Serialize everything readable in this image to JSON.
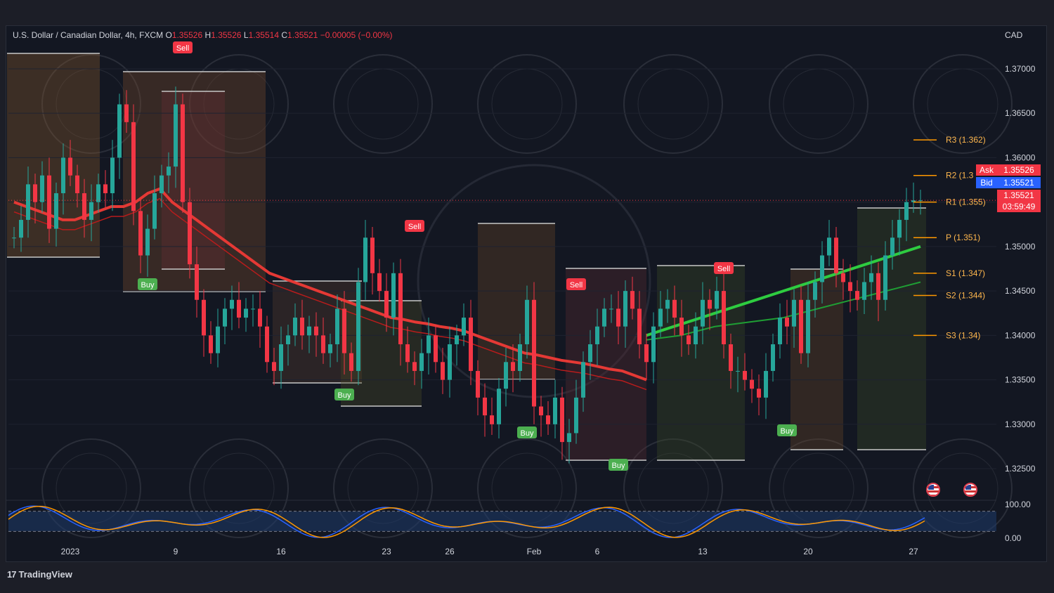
{
  "symbol": {
    "name": "U.S. Dollar / Canadian Dollar, 4h, FXCM",
    "open_label": "O",
    "open": "1.35526",
    "high_label": "H",
    "high": "1.35526",
    "low_label": "L",
    "low": "1.35514",
    "close_label": "C",
    "close": "1.35521",
    "change": "−0.00005 (−0.00%)"
  },
  "currency": "CAD",
  "quote": {
    "ask_label": "Ask",
    "ask": "1.35526",
    "bid_label": "Bid",
    "bid": "1.35521",
    "last": "1.35521",
    "countdown": "03:59:49"
  },
  "branding": {
    "logo_mark": "17",
    "logo_text": "TradingView"
  },
  "colors": {
    "bull": "#26a69a",
    "bear": "#f23645",
    "sell": "#f23645",
    "buy": "#4caf50",
    "pivot": "#ff9800",
    "background": "#131722"
  },
  "chart_data": {
    "type": "line",
    "title": "U.S. Dollar / Canadian Dollar, 4h, FXCM",
    "ylim": [
      1.322,
      1.373
    ],
    "y_ticks": [
      "1.37000",
      "1.36500",
      "1.36000",
      "1.35500",
      "1.35000",
      "1.34500",
      "1.34000",
      "1.33500",
      "1.33000",
      "1.32500"
    ],
    "y_tick_values": [
      1.37,
      1.365,
      1.36,
      1.355,
      1.35,
      1.345,
      1.34,
      1.335,
      1.33,
      1.325
    ],
    "x_ticks": [
      "2023",
      "9",
      "16",
      "23",
      "26",
      "Feb",
      "6",
      "13",
      "20",
      "27"
    ],
    "x_tick_index": [
      8,
      23,
      38,
      53,
      62,
      74,
      83,
      98,
      113,
      128
    ],
    "x_count": 130,
    "series": [
      {
        "values": [
          1.351,
          1.353,
          1.357,
          1.355,
          1.358,
          1.352,
          1.356,
          1.36,
          1.358,
          1.356,
          1.353,
          1.355,
          1.357,
          1.356,
          1.36,
          1.366,
          1.364,
          1.354,
          1.349,
          1.352,
          1.356,
          1.358,
          1.359,
          1.366,
          1.355,
          1.348,
          1.344,
          1.34,
          1.338,
          1.341,
          1.343,
          1.344,
          1.342,
          1.343,
          1.343,
          1.341,
          1.337,
          1.336,
          1.339,
          1.34,
          1.342,
          1.34,
          1.341,
          1.34,
          1.338,
          1.339,
          1.343,
          1.338,
          1.336,
          1.346,
          1.351,
          1.347,
          1.345,
          1.342,
          1.347,
          1.339,
          1.337,
          1.336,
          1.338,
          1.34,
          1.337,
          1.335,
          1.339,
          1.34,
          1.342,
          1.336,
          1.333,
          1.331,
          1.33,
          1.334,
          1.337,
          1.336,
          1.339,
          1.344,
          1.332,
          1.331,
          1.33,
          1.333,
          1.328,
          1.329,
          1.333,
          1.337,
          1.339,
          1.341,
          1.343,
          1.343,
          1.341,
          1.345,
          1.343,
          1.339,
          1.337,
          1.341,
          1.343,
          1.344,
          1.342,
          1.34,
          1.339,
          1.341,
          1.344,
          1.343,
          1.345,
          1.339,
          1.336,
          1.336,
          1.335,
          1.334,
          1.333,
          1.336,
          1.339,
          1.342,
          1.341,
          1.344,
          1.338,
          1.344,
          1.346,
          1.349,
          1.351,
          1.347,
          1.346,
          1.345,
          1.344,
          1.346,
          1.347,
          1.344,
          1.349,
          1.351,
          1.353,
          1.355,
          1.3552,
          1.3552
        ]
      },
      {
        "values": [
          1.355,
          1.3545,
          1.354,
          1.3535,
          1.353,
          1.353,
          1.3535,
          1.354,
          1.3545,
          1.3545,
          1.355,
          1.356,
          1.3565,
          1.355,
          1.354,
          1.353,
          1.352,
          1.351,
          1.35,
          1.349,
          1.348,
          1.347,
          1.3465,
          1.346,
          1.3455,
          1.345,
          1.3445,
          1.344,
          1.3435,
          1.343,
          1.3425,
          1.342,
          1.3418,
          1.3415,
          1.3413,
          1.341,
          1.3408,
          1.3405,
          1.34,
          1.3395,
          1.339,
          1.3385,
          1.338,
          1.3378,
          1.3375,
          1.3372,
          1.337,
          1.3368,
          1.3365,
          1.3362,
          1.336,
          1.3355,
          1.335
        ]
      },
      {
        "values": [
          1.34,
          1.341,
          1.342,
          1.343,
          1.344,
          1.345,
          1.346,
          1.347,
          1.348,
          1.349,
          1.35
        ]
      },
      {
        "values": [
          1.3395,
          1.34,
          1.341,
          1.3415,
          1.342,
          1.343,
          1.344,
          1.345,
          1.346
        ]
      }
    ],
    "signals": [
      {
        "label": "Sell",
        "x": 24
      },
      {
        "label": "Buy",
        "x": 19
      },
      {
        "label": "Sell",
        "x": 57
      },
      {
        "label": "Buy",
        "x": 47
      },
      {
        "label": "Sell",
        "x": 80
      },
      {
        "label": "Buy",
        "x": 73
      },
      {
        "label": "Sell",
        "x": 101
      },
      {
        "label": "Buy",
        "x": 86
      },
      {
        "label": "Buy",
        "x": 110
      }
    ],
    "pivots": [
      {
        "label": "R3 (1.362)",
        "value": 1.362
      },
      {
        "label": "R2 (1.3",
        "value": 1.358
      },
      {
        "label": "R1 (1.355)",
        "value": 1.355
      },
      {
        "label": "P (1.351)",
        "value": 1.351
      },
      {
        "label": "S1 (1.347)",
        "value": 1.347
      },
      {
        "label": "S2 (1.344)",
        "value": 1.3445
      },
      {
        "label": "S3 (1.34)",
        "value": 1.34
      }
    ],
    "oscillator": {
      "y_ticks": [
        "100.00",
        "0.00"
      ],
      "levels": [
        80,
        20
      ]
    }
  }
}
